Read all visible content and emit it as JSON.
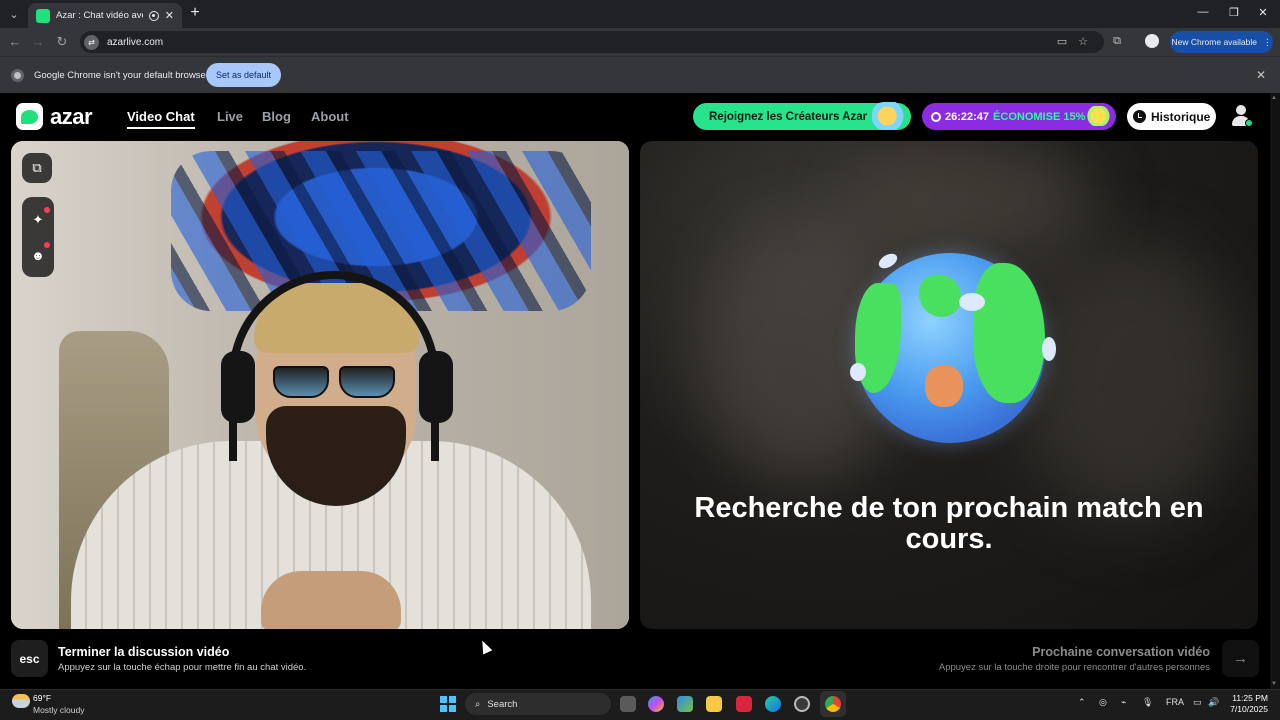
{
  "browser": {
    "tab_title": "Azar : Chat vidéo avec de n",
    "tab_close": "✕",
    "new_tab": "+",
    "url": "azarlive.com",
    "new_chrome_label": "New Chrome available",
    "infobar_text": "Google Chrome isn't your default browser",
    "set_default_label": "Set as default"
  },
  "site": {
    "logo_text": "azar",
    "nav": [
      {
        "label": "Video Chat",
        "active": true
      },
      {
        "label": "Live"
      },
      {
        "label": "Blog"
      },
      {
        "label": "About"
      }
    ],
    "creators_label": "Rejoignez les Créateurs Azar",
    "promo_timer": "26:22:47",
    "promo_text": "ÉCONOMISE 15%",
    "history_label": "Historique"
  },
  "match": {
    "searching_text": "Recherche de ton prochain match en cours."
  },
  "footer": {
    "esc_key": "esc",
    "end_title": "Terminer la discussion vidéo",
    "end_sub": "Appuyez sur la touche échap pour mettre fin au chat vidéo.",
    "next_title": "Prochaine conversation vidéo",
    "next_sub": "Appuyez sur la touche droite pour rencontrer d'autres personnes",
    "next_arrow": "→"
  },
  "taskbar": {
    "temperature": "69°F",
    "condition": "Mostly cloudy",
    "search_placeholder": "Search",
    "language": "FRA",
    "time": "11:25 PM",
    "date": "7/10/2025"
  }
}
